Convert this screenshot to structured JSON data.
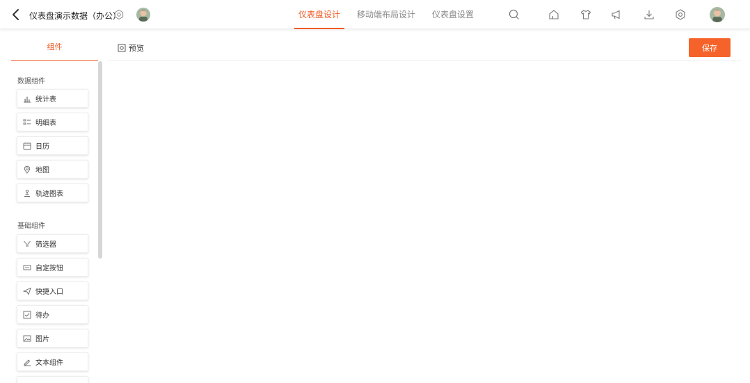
{
  "header": {
    "title": "仪表盘演示数据（办公）",
    "tabs": [
      {
        "label": "仪表盘设计",
        "active": true
      },
      {
        "label": "移动端布局设计",
        "active": false
      },
      {
        "label": "仪表盘设置",
        "active": false
      }
    ],
    "toolbar_icons": [
      "search-icon",
      "home-icon",
      "shirt-icon",
      "megaphone-icon",
      "download-icon",
      "gear-icon"
    ]
  },
  "subbar": {
    "components_tab": "组件",
    "preview_label": "预览",
    "save_label": "保存"
  },
  "sidebar": {
    "data_group_title": "数据组件",
    "data_items": [
      {
        "label": "统计表",
        "icon": "bar-chart-icon"
      },
      {
        "label": "明细表",
        "icon": "list-icon"
      },
      {
        "label": "日历",
        "icon": "calendar-icon"
      },
      {
        "label": "地图",
        "icon": "map-pin-icon"
      },
      {
        "label": "轨迹图表",
        "icon": "track-icon"
      }
    ],
    "basic_group_title": "基础组件",
    "basic_items": [
      {
        "label": "筛选器",
        "icon": "filter-icon"
      },
      {
        "label": "自定按钮",
        "icon": "button-icon"
      },
      {
        "label": "快捷入口",
        "icon": "shortcut-icon"
      },
      {
        "label": "待办",
        "icon": "todo-icon"
      },
      {
        "label": "图片",
        "icon": "image-icon"
      },
      {
        "label": "文本组件",
        "icon": "text-icon"
      }
    ]
  },
  "colors": {
    "accent": "#ee5a24",
    "save_button": "#f5632a"
  }
}
